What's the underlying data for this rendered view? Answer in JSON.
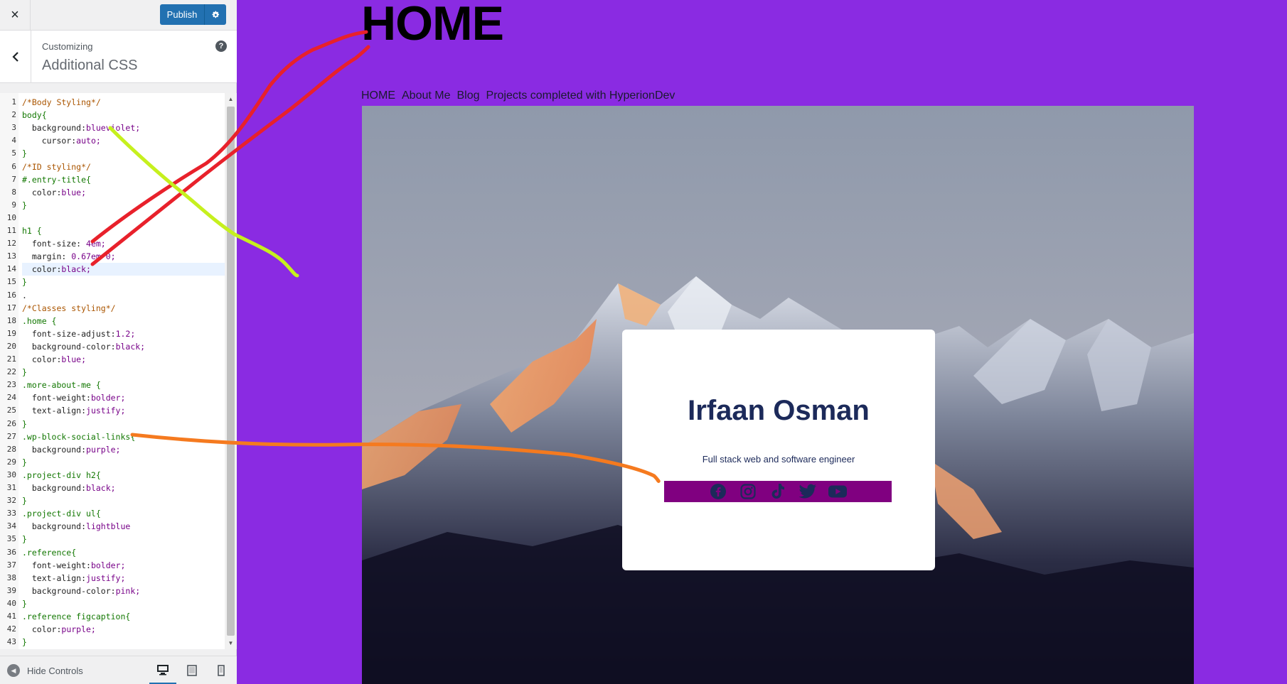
{
  "topbar": {
    "close_icon": "×",
    "publish_label": "Publish",
    "publish_settings_icon": "gear-icon"
  },
  "section": {
    "breadcrumb": "Customizing",
    "title": "Additional CSS",
    "help_icon": "?"
  },
  "editor": {
    "active_line": 14,
    "lines": [
      "/*Body Styling*/",
      "body{",
      "  background:blueviolet;",
      "    cursor:auto;",
      "}",
      "/*ID styling*/",
      "#.entry-title{",
      "  color:blue;",
      "}",
      "",
      "h1 {",
      "  font-size: 4em;",
      "  margin: 0.67em 0;",
      "  color:black;",
      "}",
      ".",
      "/*Classes styling*/",
      ".home {",
      "  font-size-adjust:1.2;",
      "  background-color:black;",
      "  color:blue;",
      "}",
      ".more-about-me {",
      "  font-weight:bolder;",
      "  text-align:justify;",
      "}",
      ".wp-block-social-links{",
      "  background:purple;",
      "}",
      ".project-div h2{",
      "  background:black;",
      "}",
      ".project-div ul{",
      "  background:lightblue",
      "}",
      ".reference{",
      "  font-weight:bolder;",
      "  text-align:justify;",
      "  background-color:pink;",
      "}",
      ".reference figcaption{",
      "  color:purple;",
      "}"
    ]
  },
  "footer": {
    "hide_controls_label": "Hide Controls",
    "devices": [
      "desktop-icon",
      "tablet-icon",
      "mobile-icon"
    ]
  },
  "preview": {
    "site_title": "HOME",
    "nav": [
      "HOME",
      "About Me",
      "Blog",
      "Projects completed with HyperionDev"
    ],
    "card": {
      "name": "Irfaan Osman",
      "tagline": "Full stack web and software engineer",
      "social": [
        "facebook-icon",
        "instagram-icon",
        "tiktok-icon",
        "twitter-icon",
        "youtube-icon"
      ]
    }
  },
  "colors": {
    "page_background": "#8a2be2",
    "publish": "#2271b1",
    "social_bar": "#800080",
    "name_text": "#1c2a5a",
    "annotation_red": "#e8212b",
    "annotation_lime": "#c6f01e",
    "annotation_orange": "#f57a1f"
  }
}
